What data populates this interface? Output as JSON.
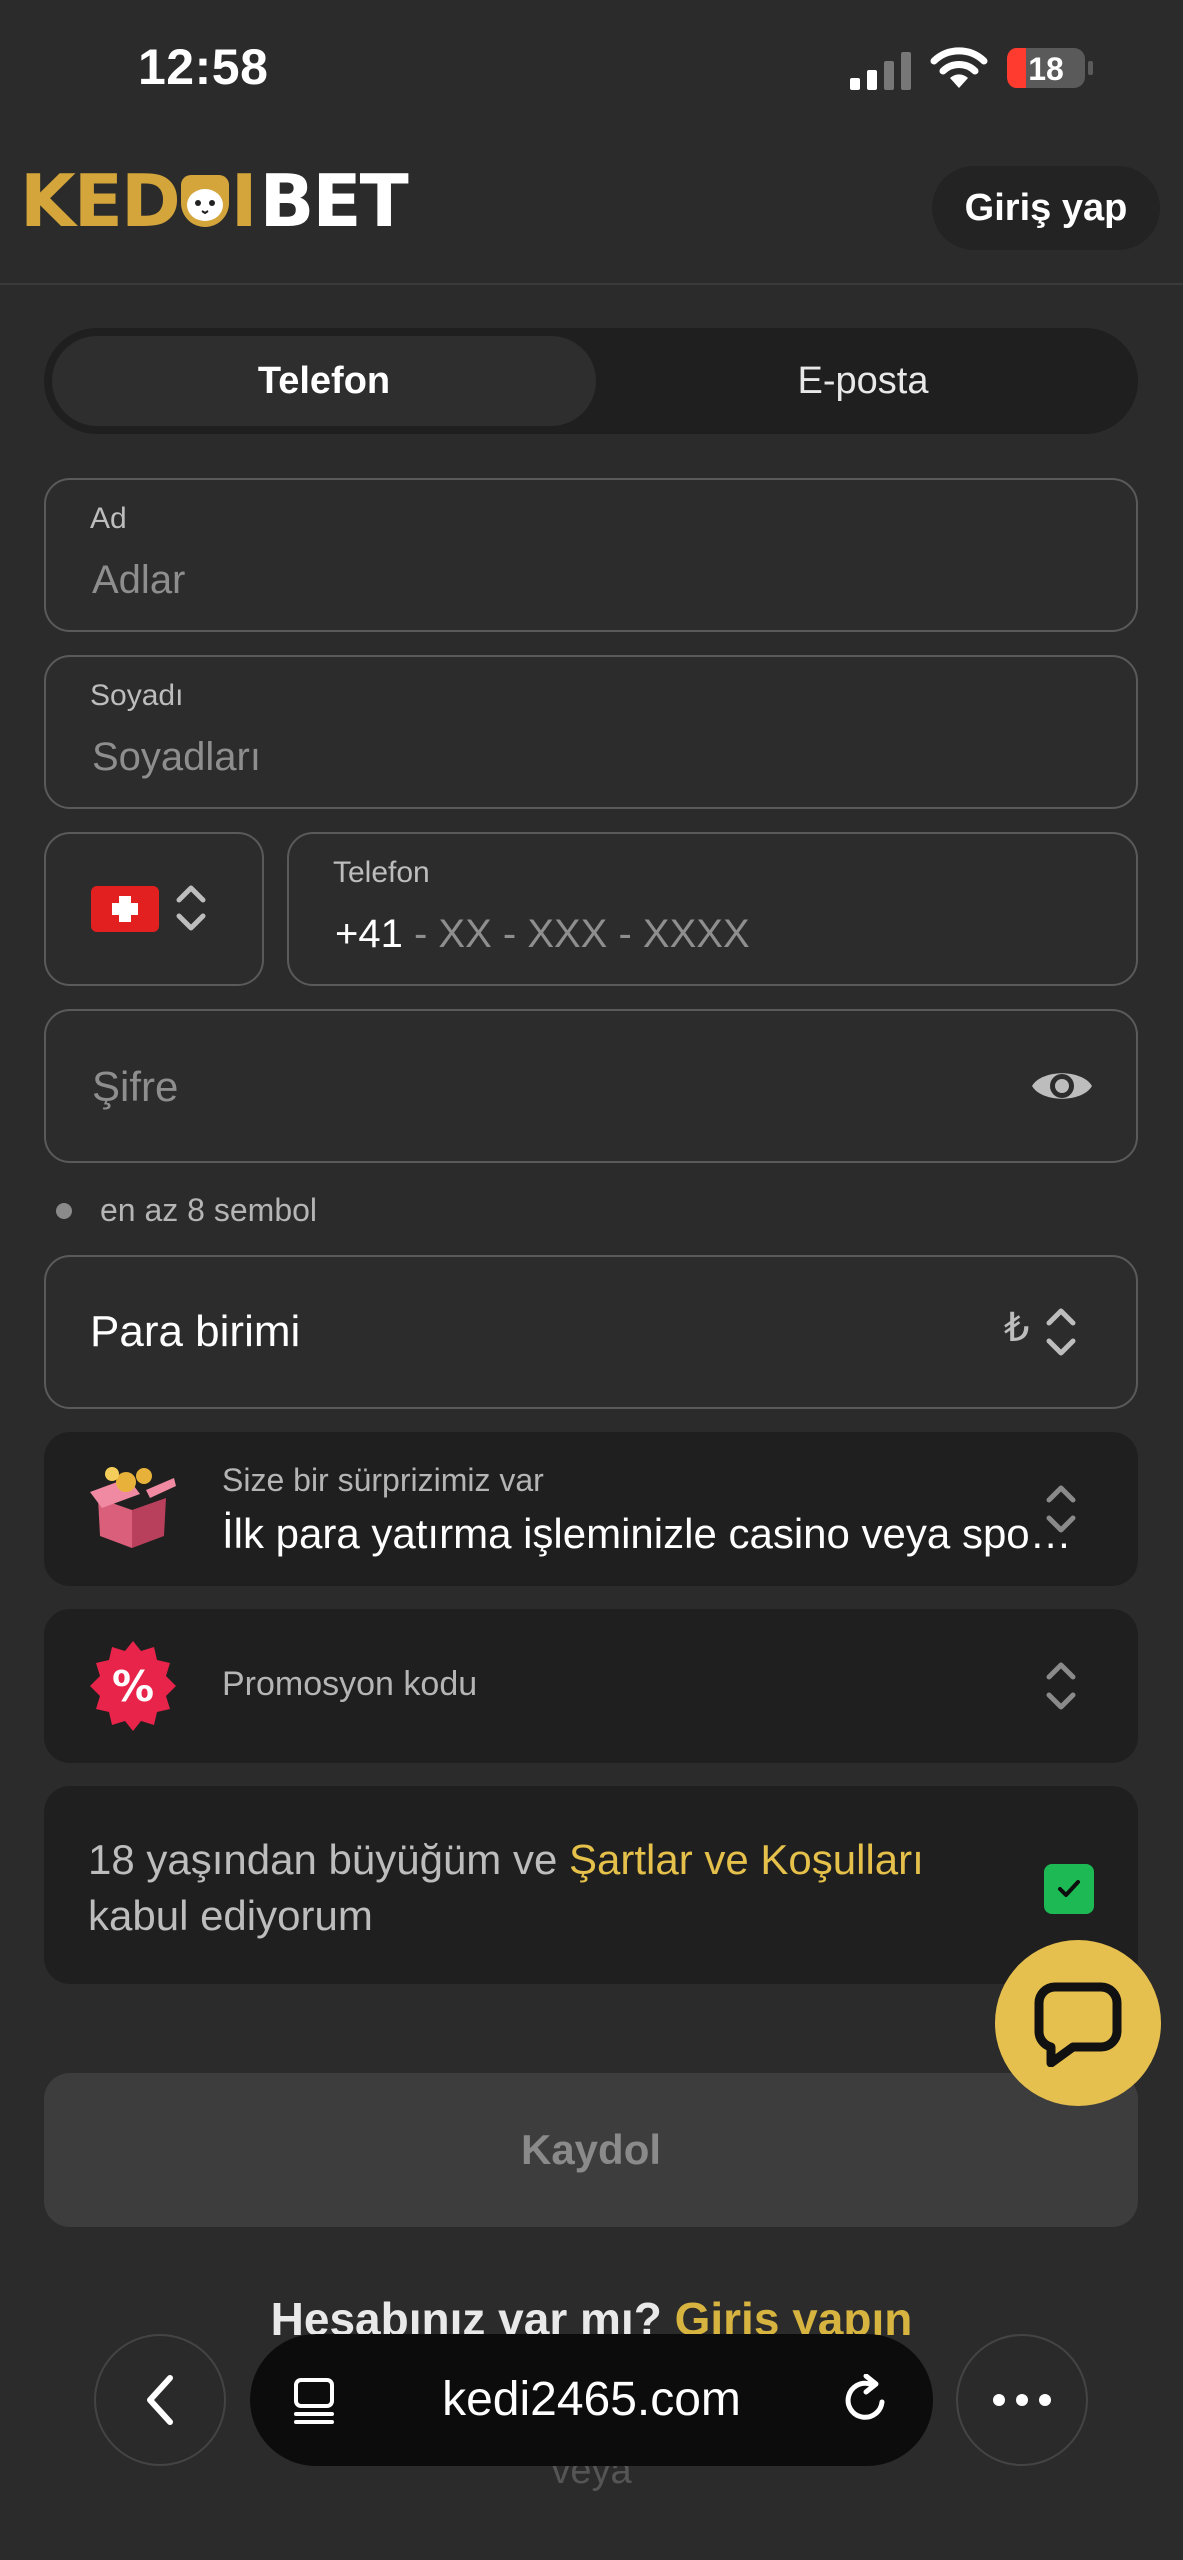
{
  "status_bar": {
    "time": "12:58",
    "battery": "18"
  },
  "header": {
    "logo_left": "KED",
    "logo_right": "BET",
    "login_label": "Giriş yap"
  },
  "tabs": [
    {
      "label": "Telefon"
    },
    {
      "label": "E-posta"
    }
  ],
  "form": {
    "name": {
      "label": "Ad",
      "placeholder": "Adlar"
    },
    "surname": {
      "label": "Soyadı",
      "placeholder": "Soyadları"
    },
    "phone": {
      "label": "Telefon",
      "prefix": "+41",
      "mask": " - XX - XXX - XXXX"
    },
    "password": {
      "placeholder": "Şifre",
      "hint": "en az 8 sembol"
    },
    "currency": {
      "label": "Para birimi",
      "symbol": "₺"
    },
    "bonus": {
      "title": "Size bir sürprizimiz var",
      "description": "İlk para yatırma işleminizle casino veya spor bonusu alın"
    },
    "promo": {
      "label": "Promosyon kodu"
    },
    "terms": {
      "text_before": "18 yaşından büyüğüm ve ",
      "link": "Şartlar ve Koşulları",
      "text_after": " kabul ediyorum",
      "checked": true
    },
    "register_label": "Kaydol"
  },
  "footer": {
    "question": "Hesabınız var mı? ",
    "login_link": "Giriş yapın",
    "or": "veya"
  },
  "browser": {
    "url": "kedi2465.com"
  },
  "colors": {
    "accent": "#e6c04e",
    "link": "#e5c04a",
    "check": "#1db954",
    "background": "#2b2b2b"
  }
}
